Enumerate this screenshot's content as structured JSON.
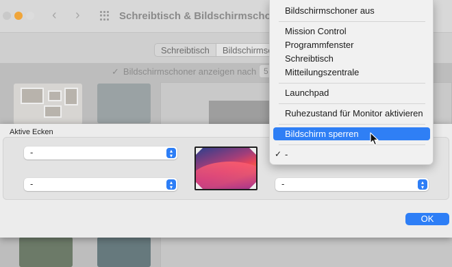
{
  "window": {
    "title": "Schreibtisch & Bildschirmschoner",
    "tabs": [
      "Schreibtisch",
      "Bildschirmschoner"
    ],
    "show_screensaver_label": "Bildschirmschoner anzeigen nach",
    "minutes_value": "5"
  },
  "sheet": {
    "title": "Aktive Ecken",
    "top_left_value": "-",
    "bottom_left_value": "-",
    "bottom_right_value": "-",
    "ok_label": "OK"
  },
  "menu": {
    "items": [
      {
        "label": "Bildschirmschoner aus"
      },
      {
        "label": "Mission Control"
      },
      {
        "label": "Programmfenster"
      },
      {
        "label": "Schreibtisch"
      },
      {
        "label": "Mitteilungszentrale"
      },
      {
        "label": "Launchpad"
      },
      {
        "label": "Ruhezustand für Monitor aktivieren"
      },
      {
        "label": "Bildschirm sperren"
      },
      {
        "label": "-"
      }
    ],
    "highlighted_index": 7,
    "checked_index": 8
  },
  "colors": {
    "accent": "#2d7ef6",
    "menu_highlight": "#2f7ff5"
  },
  "icons": {
    "checkmark": "checkmark-icon",
    "stepper": "stepper-chevrons-icon",
    "grid": "grid-icon",
    "cursor": "arrow-cursor-icon"
  }
}
